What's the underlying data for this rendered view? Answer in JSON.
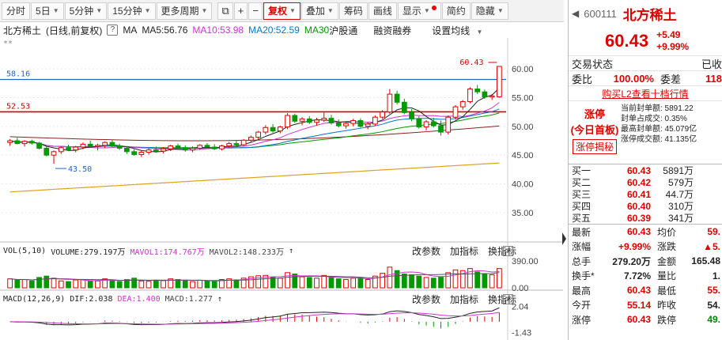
{
  "toolbar": {
    "items": [
      "分时",
      "5日",
      "5分钟",
      "15分钟",
      "更多周期",
      "复权",
      "叠加",
      "筹码",
      "画线",
      "显示",
      "简约",
      "隐藏"
    ],
    "tool_icons": [
      "popup-icon",
      "plus-icon",
      "minus-icon"
    ]
  },
  "title": {
    "name": "北方稀土",
    "mode": "(日线,前复权)",
    "ma_label": "MA",
    "ma5": "MA5:56.76",
    "ma10": "MA10:53.98",
    "ma20": "MA20:52.59",
    "ma30": "MA30",
    "hgt": "沪股通",
    "rzrq": "融资融券",
    "set_ma": "设置均线"
  },
  "colors": {
    "up": "#e00000",
    "down": "#009900",
    "ma5": "#222222",
    "ma10": "#cc33cc",
    "ma20": "#0077cc",
    "ma30": "#009900",
    "ma60": "#8a2020",
    "ma250": "#e0a020",
    "blue_line": "#2266cc",
    "red_line": "#cc0000"
  },
  "chart_data": [
    {
      "type": "candlestick",
      "y_axis_ticks": [
        "60.00",
        "55.00",
        "50.00",
        "45.00",
        "40.00",
        "35.00"
      ],
      "ylim": [
        31,
        64
      ],
      "annotations": {
        "high": "60.43",
        "low": "43.50",
        "blue_level": "58.16",
        "red_level": "52.53"
      },
      "candles": [
        [
          47.2,
          47.8,
          46.6,
          47.5
        ],
        [
          47.5,
          48.0,
          46.9,
          47.0
        ],
        [
          47.0,
          47.6,
          46.5,
          47.4
        ],
        [
          47.4,
          47.7,
          46.8,
          47.1
        ],
        [
          47.1,
          47.3,
          46.0,
          46.2
        ],
        [
          46.2,
          46.5,
          44.8,
          45.0
        ],
        [
          45.0,
          45.8,
          43.5,
          45.6
        ],
        [
          45.6,
          46.5,
          45.2,
          46.3
        ],
        [
          46.3,
          46.8,
          45.7,
          45.9
        ],
        [
          45.9,
          46.6,
          45.5,
          46.4
        ],
        [
          46.4,
          47.2,
          46.0,
          46.9
        ],
        [
          46.9,
          47.5,
          46.3,
          46.5
        ],
        [
          46.5,
          47.0,
          45.8,
          46.7
        ],
        [
          46.7,
          47.4,
          46.2,
          47.2
        ],
        [
          47.2,
          47.6,
          46.4,
          46.6
        ],
        [
          46.6,
          47.0,
          45.9,
          46.2
        ],
        [
          46.2,
          46.6,
          45.2,
          45.6
        ],
        [
          45.6,
          46.0,
          44.9,
          45.1
        ],
        [
          45.1,
          45.8,
          44.7,
          45.5
        ],
        [
          45.5,
          46.2,
          45.1,
          45.9
        ],
        [
          45.9,
          46.5,
          45.4,
          45.7
        ],
        [
          45.7,
          46.4,
          45.3,
          46.1
        ],
        [
          46.1,
          46.8,
          45.7,
          46.6
        ],
        [
          46.6,
          47.0,
          46.0,
          46.3
        ],
        [
          46.3,
          46.7,
          45.6,
          45.9
        ],
        [
          45.9,
          46.5,
          45.5,
          46.2
        ],
        [
          46.2,
          46.9,
          45.9,
          46.7
        ],
        [
          46.7,
          47.1,
          46.1,
          46.4
        ],
        [
          46.4,
          46.9,
          45.9,
          46.1
        ],
        [
          46.1,
          46.8,
          45.8,
          46.6
        ],
        [
          46.6,
          47.3,
          46.3,
          47.0
        ],
        [
          47.0,
          47.5,
          46.4,
          46.8
        ],
        [
          46.8,
          47.8,
          46.5,
          47.6
        ],
        [
          47.6,
          48.4,
          47.2,
          48.1
        ],
        [
          48.1,
          49.2,
          47.8,
          49.0
        ],
        [
          49.0,
          50.2,
          48.6,
          49.8
        ],
        [
          49.8,
          50.4,
          48.9,
          49.2
        ],
        [
          49.2,
          50.1,
          48.8,
          49.9
        ],
        [
          49.9,
          52.3,
          49.5,
          51.9
        ],
        [
          51.9,
          52.2,
          50.6,
          50.9
        ],
        [
          50.9,
          51.6,
          50.2,
          51.3
        ],
        [
          51.3,
          51.8,
          50.4,
          50.7
        ],
        [
          50.7,
          51.5,
          50.1,
          51.1
        ],
        [
          51.1,
          52.4,
          50.8,
          51.4
        ],
        [
          51.4,
          52.0,
          50.3,
          50.6
        ],
        [
          50.6,
          51.2,
          49.8,
          50.1
        ],
        [
          50.1,
          50.9,
          49.6,
          50.5
        ],
        [
          50.5,
          51.3,
          50.0,
          51.0
        ],
        [
          51.0,
          51.4,
          49.8,
          50.0
        ],
        [
          50.0,
          50.8,
          49.5,
          50.4
        ],
        [
          50.4,
          51.9,
          50.1,
          51.6
        ],
        [
          51.6,
          52.8,
          51.3,
          52.5
        ],
        [
          52.5,
          56.5,
          52.2,
          55.6
        ],
        [
          55.6,
          56.2,
          53.8,
          54.2
        ],
        [
          54.2,
          54.8,
          52.1,
          52.4
        ],
        [
          52.4,
          53.0,
          50.9,
          51.3
        ],
        [
          51.3,
          51.8,
          49.6,
          49.9
        ],
        [
          49.9,
          51.1,
          49.3,
          50.8
        ],
        [
          50.8,
          51.5,
          49.8,
          50.1
        ],
        [
          50.1,
          51.0,
          48.4,
          49.0
        ],
        [
          49.0,
          51.9,
          48.6,
          51.6
        ],
        [
          51.6,
          53.7,
          51.2,
          53.4
        ],
        [
          53.4,
          54.6,
          52.9,
          54.3
        ],
        [
          54.3,
          56.8,
          54.0,
          56.5
        ],
        [
          56.5,
          57.2,
          55.6,
          56.0
        ],
        [
          56.0,
          56.4,
          54.8,
          55.1
        ],
        [
          55.1,
          55.6,
          54.6,
          55.3
        ],
        [
          55.14,
          60.43,
          55.0,
          60.43
        ]
      ]
    },
    {
      "type": "bar",
      "name": "VOL",
      "params": "VOL(5,10)",
      "volume_label": "VOLUME:279.197万",
      "mavol1_label": "MAVOL1:174.767万",
      "mavol2_label": "MAVOL2:148.233万",
      "y_axis_ticks": [
        "390.00",
        "0.00"
      ],
      "values": [
        130,
        110,
        120,
        100,
        150,
        170,
        140,
        100,
        90,
        115,
        120,
        95,
        100,
        130,
        110,
        90,
        120,
        140,
        100,
        95,
        110,
        105,
        130,
        120,
        100,
        90,
        110,
        100,
        95,
        120,
        130,
        115,
        140,
        160,
        175,
        180,
        150,
        140,
        220,
        200,
        160,
        150,
        140,
        180,
        160,
        130,
        120,
        140,
        150,
        120,
        170,
        210,
        300,
        250,
        200,
        190,
        170,
        150,
        140,
        160,
        220,
        260,
        250,
        280,
        230,
        200,
        190,
        279
      ],
      "ylim": [
        0,
        390
      ]
    },
    {
      "type": "line",
      "name": "MACD",
      "params": "MACD(12,26,9)",
      "dif_label": "DIF:2.038",
      "dea_label": "DEA:1.400",
      "macd_label": "MACD:1.277",
      "y_axis_ticks": [
        "2.04",
        "-1.43"
      ],
      "ylim": [
        -1.8,
        2.4
      ]
    }
  ],
  "panel_actions": {
    "params": "改参数",
    "add": "加指标",
    "swap": "换指标"
  },
  "quote": {
    "code": "600111",
    "name": "北方稀土",
    "price": "60.43",
    "change": "+5.49",
    "change_pct": "+9.99%",
    "trade_status_label": "交易状态",
    "trade_status_value": "已收",
    "weibi_label": "委比",
    "weibi_value": "100.00%",
    "weicha_label": "委差",
    "weicha_value": "118",
    "l2_link": "购买L2查看十档行情",
    "zt_title": "涨停",
    "zt_sub": "(今日首板)",
    "zt_reveal": "涨停揭秘",
    "zt_details": [
      "当前封单额: 5891.22",
      "封单占成交: 0.35%",
      "最高封单额: 45.079亿",
      "涨停成交额: 41.135亿"
    ],
    "order_book": [
      {
        "label": "买一",
        "price": "60.43",
        "vol": "5891万"
      },
      {
        "label": "买二",
        "price": "60.42",
        "vol": "579万"
      },
      {
        "label": "买三",
        "price": "60.41",
        "vol": "44.7万"
      },
      {
        "label": "买四",
        "price": "60.40",
        "vol": "310万"
      },
      {
        "label": "买五",
        "price": "60.39",
        "vol": "341万"
      }
    ],
    "stats": [
      {
        "k1": "最新",
        "v1": "60.43",
        "k2": "均价",
        "v2": "59.",
        "c1": "red",
        "c2": "red"
      },
      {
        "k1": "涨幅",
        "v1": "+9.99%",
        "k2": "涨跌",
        "v2": "▲5.",
        "c1": "red",
        "c2": "red"
      },
      {
        "k1": "总手",
        "v1": "279.20万",
        "k2": "金额",
        "v2": "165.48",
        "c1": "dark",
        "c2": "dark"
      },
      {
        "k1": "换手*",
        "v1": "7.72%",
        "k2": "量比",
        "v2": "1.",
        "c1": "dark",
        "c2": "dark"
      },
      {
        "k1": "最高",
        "v1": "60.43",
        "k2": "最低",
        "v2": "55.",
        "c1": "red",
        "c2": "red"
      },
      {
        "k1": "今开",
        "v1": "55.14",
        "k2": "昨收",
        "v2": "54.",
        "c1": "red",
        "c2": "dark"
      },
      {
        "k1": "涨停",
        "v1": "60.43",
        "k2": "跌停",
        "v2": "49.",
        "c1": "red",
        "c2": "grn"
      }
    ]
  }
}
